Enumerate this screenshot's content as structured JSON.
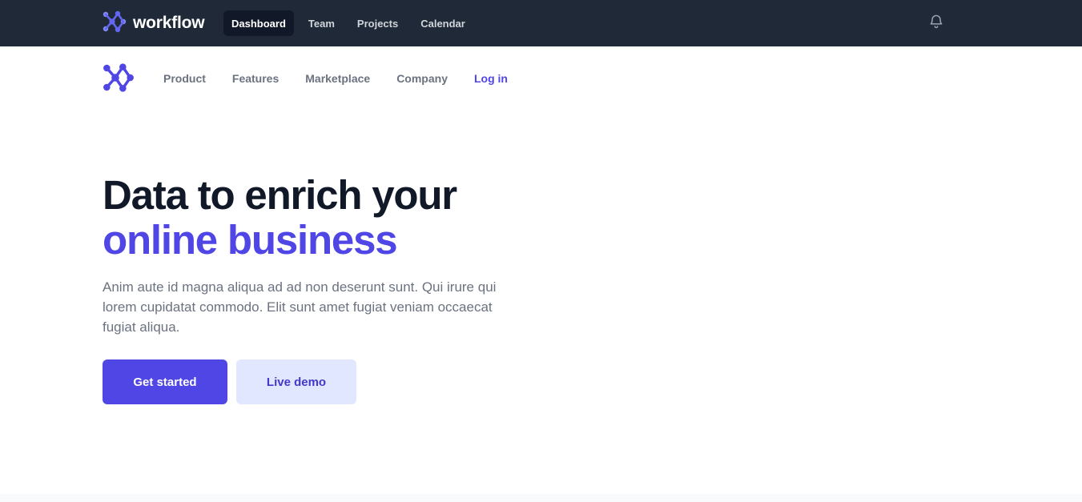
{
  "app": {
    "brand_name": "workflow",
    "logo_icon": "workflow-logo-icon",
    "accent_color": "#4f46e5"
  },
  "topnav": {
    "items": [
      {
        "label": "Dashboard",
        "active": true
      },
      {
        "label": "Team",
        "active": false
      },
      {
        "label": "Projects",
        "active": false
      },
      {
        "label": "Calendar",
        "active": false
      }
    ],
    "notifications_icon": "bell-icon"
  },
  "subnav": {
    "links": [
      "Product",
      "Features",
      "Marketplace",
      "Company"
    ],
    "login_label": "Log in"
  },
  "hero": {
    "title_line1": "Data to enrich your",
    "title_line2": "online business",
    "description": "Anim aute id magna aliqua ad ad non deserunt sunt. Qui irure qui lorem cupidatat commodo. Elit sunt amet fugiat veniam occaecat fugiat aliqua.",
    "primary_button": "Get started",
    "secondary_button": "Live demo"
  }
}
